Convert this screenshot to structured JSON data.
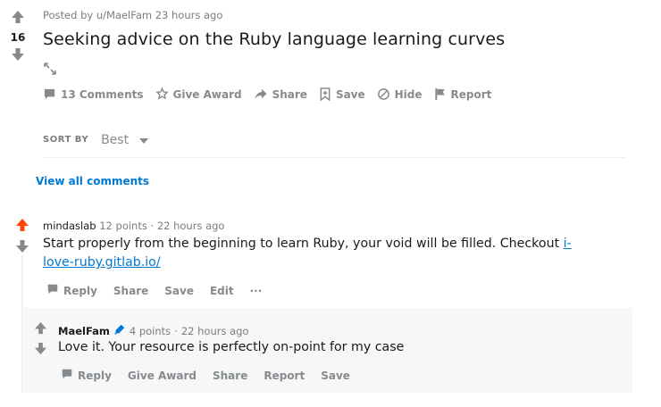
{
  "post": {
    "meta": "Posted by u/MaelFam 23 hours ago",
    "score": "16",
    "title": "Seeking advice on the Ruby language learning curves",
    "actions": {
      "comments": "13 Comments",
      "award": "Give Award",
      "share": "Share",
      "save": "Save",
      "hide": "Hide",
      "report": "Report"
    }
  },
  "sort": {
    "label": "SORT BY",
    "value": "Best"
  },
  "view_all": "View all comments",
  "comments": [
    {
      "author": "mindaslab",
      "points": "12 points",
      "sep": "·",
      "time": "22 hours ago",
      "body_text": "Start properly from the beginning to learn Ruby, your void will be filled. Checkout ",
      "body_link": "i-love-ruby.gitlab.io/",
      "actions": {
        "reply": "Reply",
        "share": "Share",
        "save": "Save",
        "edit": "Edit",
        "more": "···"
      }
    },
    {
      "author": "MaelFam",
      "points": "4 points",
      "sep": "·",
      "time": "22 hours ago",
      "body_text": "Love it. Your resource is perfectly on-point for my case",
      "actions": {
        "reply": "Reply",
        "award": "Give Award",
        "share": "Share",
        "report": "Report",
        "save": "Save"
      }
    }
  ],
  "colors": {
    "upvote_active": "#ff4500",
    "vote_inactive": "#878a8c",
    "link": "#0079d3",
    "reply_bg": "#f6f7f8"
  }
}
